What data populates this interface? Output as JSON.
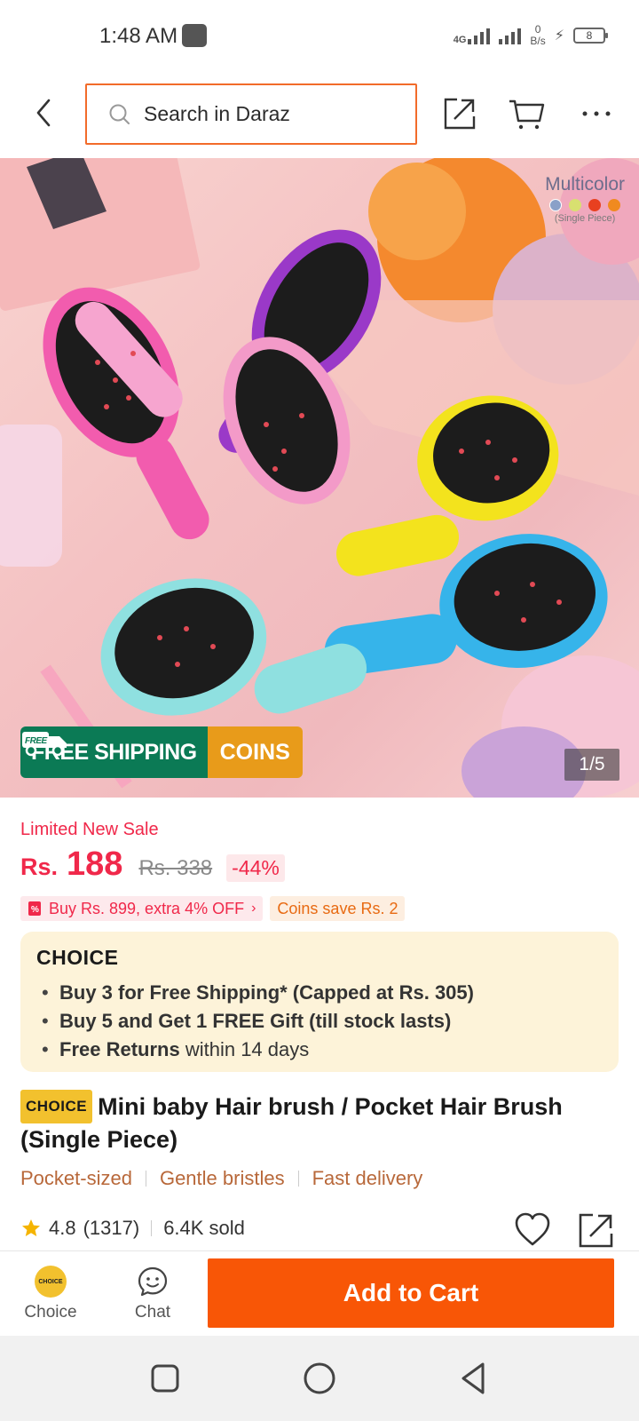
{
  "status_bar": {
    "time": "1:48 AM",
    "network_type": "4G",
    "speed_value": "0",
    "speed_unit": "B/s",
    "battery": "8"
  },
  "header": {
    "search_placeholder": "Search in Daraz",
    "back_icon": "chevron-left-icon",
    "share_icon": "share-icon",
    "cart_icon": "cart-icon",
    "more_icon": "more-icon"
  },
  "hero": {
    "variant_title": "Multicolor",
    "variant_sub": "(Single Piece)",
    "variant_colors": [
      "#8aa0c8",
      "#d8e070",
      "#e84020",
      "#f08a20"
    ],
    "shipping_badge": "FREE SHIPPING",
    "shipping_tag_word": "FREE",
    "coins_badge": "COINS",
    "page_indicator": "1/5"
  },
  "product": {
    "sale_label": "Limited New Sale",
    "currency": "Rs.",
    "price": "188",
    "old_price": "Rs. 338",
    "discount": "-44%",
    "promo_buy": "Buy Rs. 899, extra 4% OFF",
    "promo_coins": "Coins save Rs. 2",
    "title_badge": "CHOICE",
    "title": "Mini baby Hair brush / Pocket Hair Brush (Single Piece)",
    "tags": [
      "Pocket-sized",
      "Gentle bristles",
      "Fast delivery"
    ],
    "rating": "4.8",
    "rating_count": "(1317)",
    "sold": "6.4K sold"
  },
  "choice_box": {
    "logo": "CHOICE",
    "items": [
      {
        "bold": "Buy 3 for  Free Shipping* (Capped at Rs. 305)",
        "rest": ""
      },
      {
        "bold": "Buy 5 and Get 1 FREE Gift (till stock lasts)",
        "rest": ""
      },
      {
        "bold": "Free Returns",
        "rest": " within 14 days"
      }
    ]
  },
  "action_bar": {
    "choice_label": "Choice",
    "choice_coin_text": "CHOICE",
    "chat_label": "Chat",
    "add_to_cart": "Add to Cart"
  },
  "colors": {
    "accent": "#f85606",
    "price": "#f0284a",
    "search_border": "#f26b2a",
    "shipping_green": "#0b7a55",
    "coins_orange": "#e89b1a",
    "choice_bg": "#fdf3d9"
  }
}
